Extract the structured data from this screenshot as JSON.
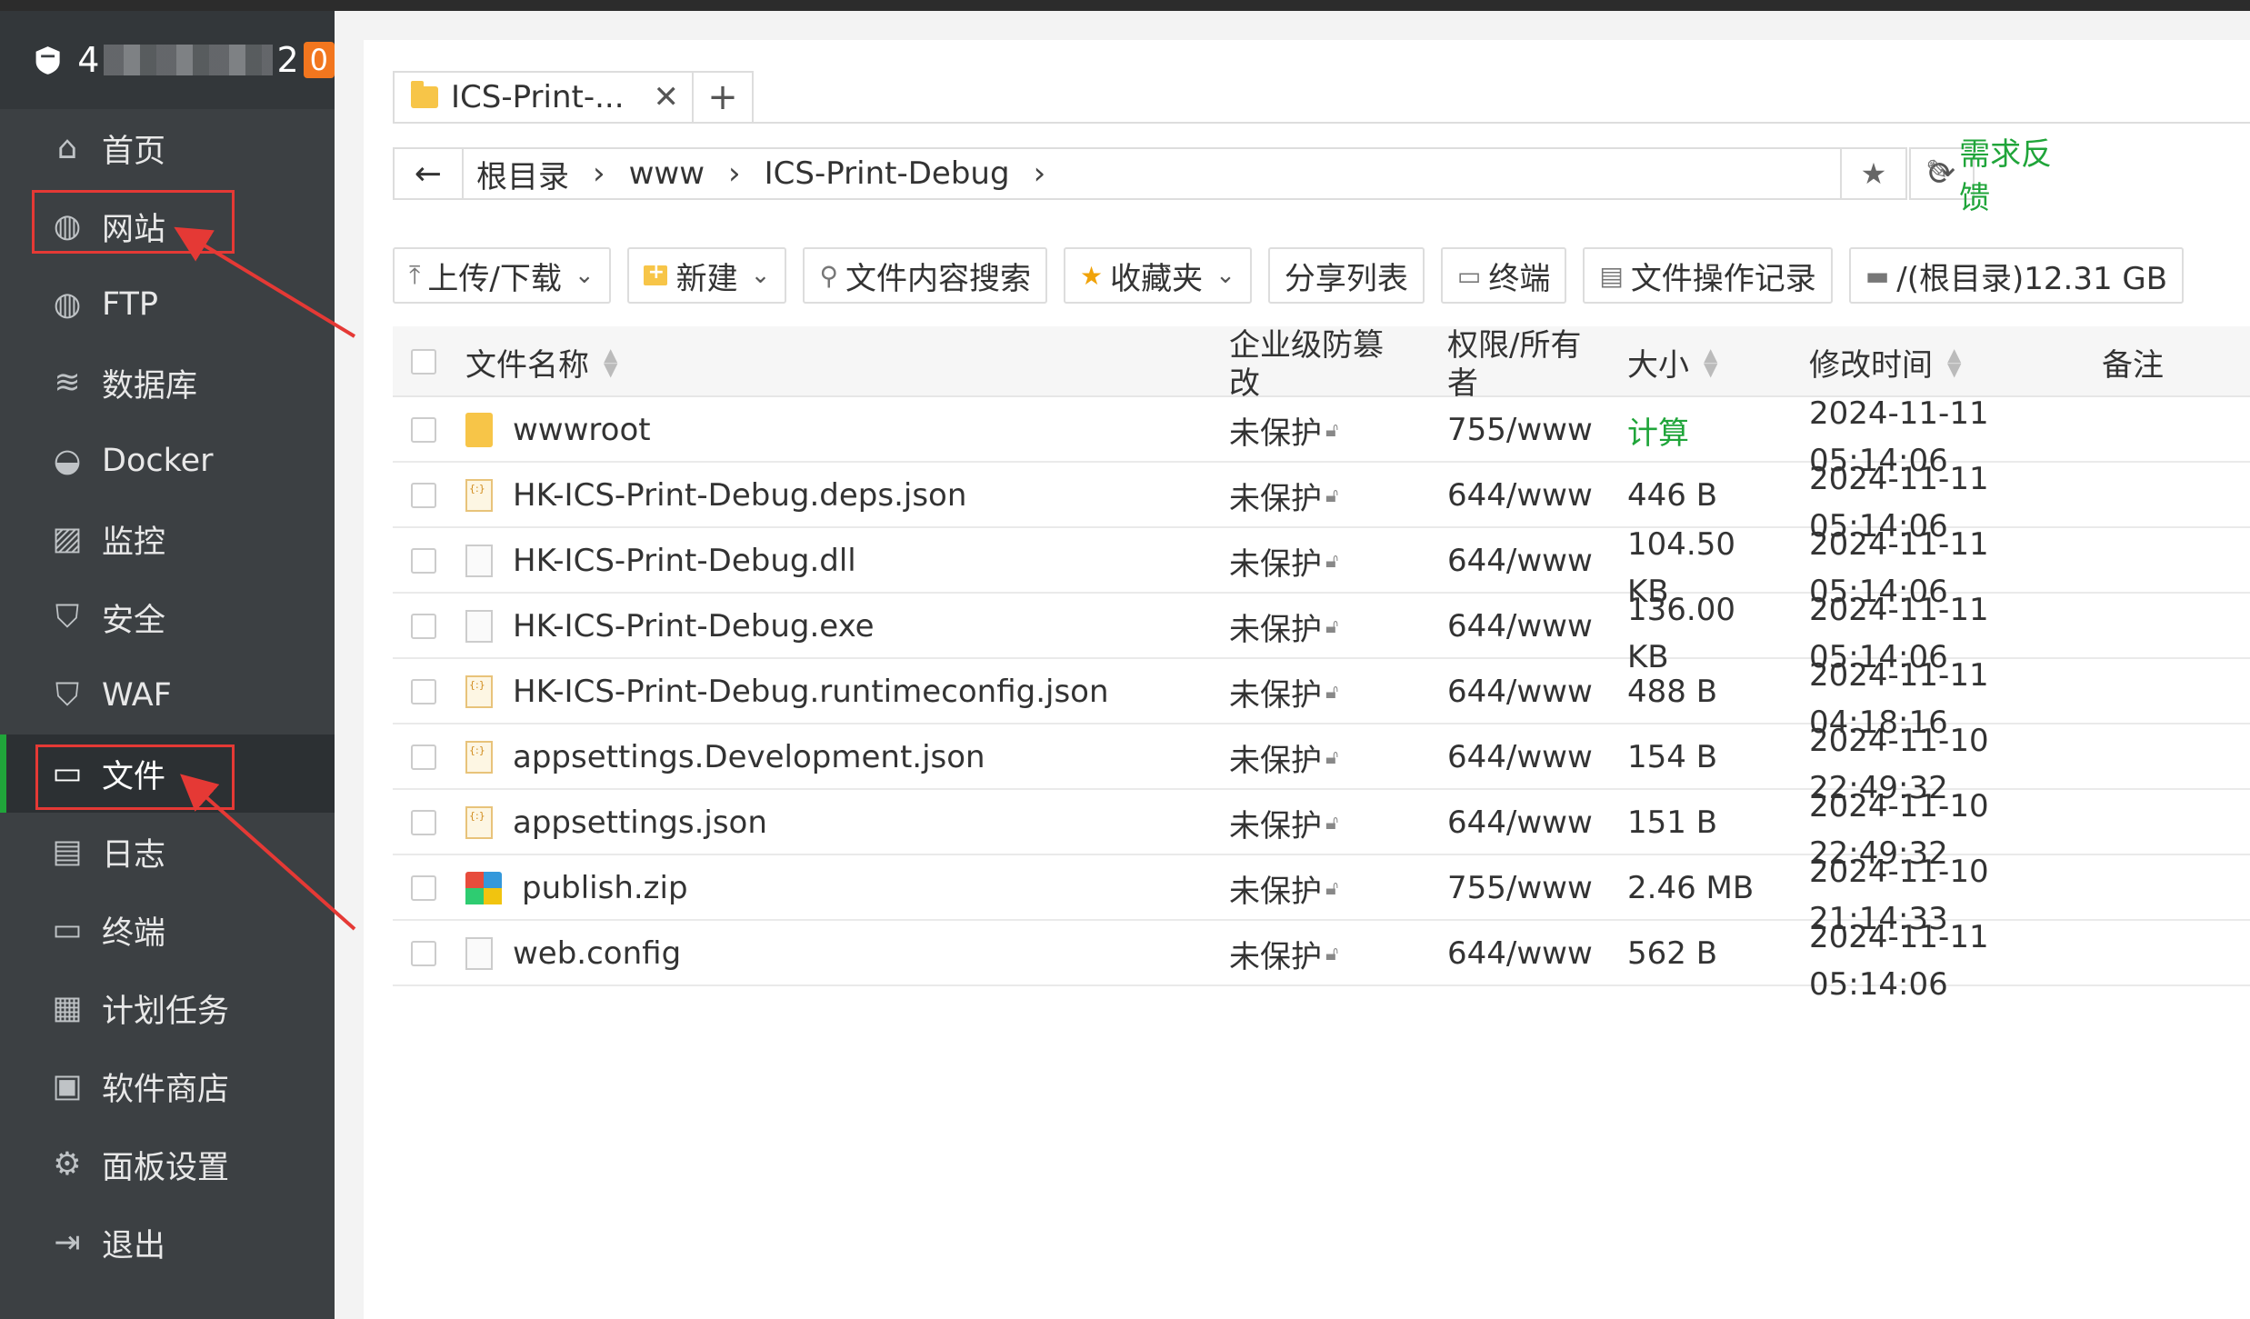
{
  "brand": {
    "host_start": "4",
    "host_end": "2",
    "badge": "0"
  },
  "nav": [
    {
      "label": "首页",
      "icon": "home-icon"
    },
    {
      "label": "网站",
      "icon": "globe-icon"
    },
    {
      "label": "FTP",
      "icon": "ftp-icon"
    },
    {
      "label": "数据库",
      "icon": "database-icon"
    },
    {
      "label": "Docker",
      "icon": "docker-icon"
    },
    {
      "label": "监控",
      "icon": "monitor-icon"
    },
    {
      "label": "安全",
      "icon": "shield-icon"
    },
    {
      "label": "WAF",
      "icon": "waf-icon"
    },
    {
      "label": "文件",
      "icon": "folder-icon"
    },
    {
      "label": "日志",
      "icon": "log-icon"
    },
    {
      "label": "终端",
      "icon": "terminal-icon"
    },
    {
      "label": "计划任务",
      "icon": "calendar-icon"
    },
    {
      "label": "软件商店",
      "icon": "store-icon"
    },
    {
      "label": "面板设置",
      "icon": "gear-icon"
    },
    {
      "label": "退出",
      "icon": "logout-icon"
    }
  ],
  "tab": {
    "label": "ICS-Print-...",
    "close": "✕",
    "add": "+"
  },
  "path": {
    "back": "←",
    "crumbs": [
      "根目录",
      "www",
      "ICS-Print-Debug"
    ],
    "sep": "›",
    "star": "★",
    "refresh": "⟳"
  },
  "feedback": "需求反馈",
  "toolbar": {
    "upload": "上传/下载",
    "new": "新建",
    "search": "文件内容搜索",
    "favorites": "收藏夹",
    "share": "分享列表",
    "terminal": "终端",
    "oplog": "文件操作记录",
    "disk": "/(根目录)12.31 GB"
  },
  "columns": {
    "name": "文件名称",
    "protect": "企业级防篡改",
    "perm": "权限/所有者",
    "size": "大小",
    "mtime": "修改时间",
    "note": "备注"
  },
  "rows": [
    {
      "name": "wwwroot",
      "type": "folder",
      "protect": "未保护",
      "perm": "755/www",
      "size": "计算",
      "mtime": "2024-11-11 05:14:06"
    },
    {
      "name": "HK-ICS-Print-Debug.deps.json",
      "type": "json",
      "protect": "未保护",
      "perm": "644/www",
      "size": "446 B",
      "mtime": "2024-11-11 05:14:06"
    },
    {
      "name": "HK-ICS-Print-Debug.dll",
      "type": "file",
      "protect": "未保护",
      "perm": "644/www",
      "size": "104.50 KB",
      "mtime": "2024-11-11 05:14:06"
    },
    {
      "name": "HK-ICS-Print-Debug.exe",
      "type": "file",
      "protect": "未保护",
      "perm": "644/www",
      "size": "136.00 KB",
      "mtime": "2024-11-11 05:14:06"
    },
    {
      "name": "HK-ICS-Print-Debug.runtimeconfig.json",
      "type": "json",
      "protect": "未保护",
      "perm": "644/www",
      "size": "488 B",
      "mtime": "2024-11-11 04:18:16"
    },
    {
      "name": "appsettings.Development.json",
      "type": "json",
      "protect": "未保护",
      "perm": "644/www",
      "size": "154 B",
      "mtime": "2024-11-10 22:49:32"
    },
    {
      "name": "appsettings.json",
      "type": "json",
      "protect": "未保护",
      "perm": "644/www",
      "size": "151 B",
      "mtime": "2024-11-10 22:49:32"
    },
    {
      "name": "publish.zip",
      "type": "zip",
      "protect": "未保护",
      "perm": "755/www",
      "size": "2.46 MB",
      "mtime": "2024-11-10 21:14:33"
    },
    {
      "name": "web.config",
      "type": "file",
      "protect": "未保护",
      "perm": "644/www",
      "size": "562 B",
      "mtime": "2024-11-11 05:14:06"
    }
  ],
  "colors": {
    "accent": "#20a53a",
    "sidebar": "#3c4043",
    "annotation": "#e53935"
  }
}
